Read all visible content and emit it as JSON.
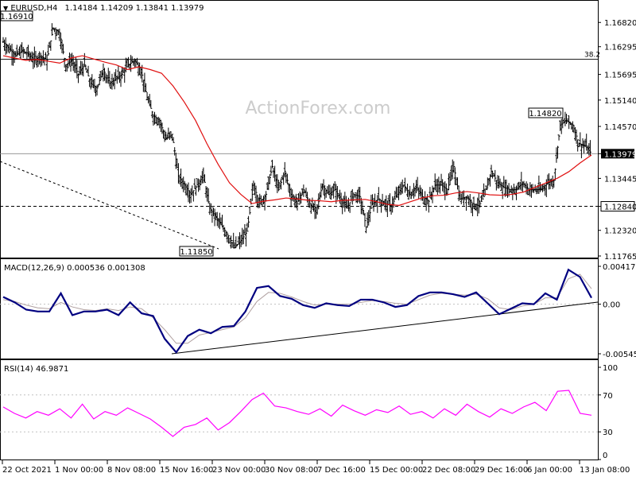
{
  "chart_data": [
    {
      "type": "line",
      "panel": "price",
      "symbol": "EURUSD,H4",
      "ohlc_header": "1.14184 1.14209 1.13841 1.13979",
      "last_price": "1.13979",
      "watermark": "ActionForex.com",
      "y_ticks": [
        "1.16820",
        "1.16295",
        "1.15695",
        "1.15140",
        "1.14570",
        "1.13979",
        "1.13445",
        "1.12840",
        "1.12320",
        "1.11765"
      ],
      "ylim": [
        1.11765,
        1.1691
      ],
      "labels": {
        "high": "1.16910",
        "low": "1.11850",
        "recent_high": "1.14820",
        "support": "1.12840",
        "fib": "38.2"
      },
      "fib_level": 1.16025,
      "support_level": 1.1284,
      "series": [
        {
          "name": "close",
          "values": [
            1.164,
            1.1625,
            1.161,
            1.162,
            1.1615,
            1.16,
            1.161,
            1.16,
            1.167,
            1.166,
            1.159,
            1.16,
            1.157,
            1.159,
            1.155,
            1.154,
            1.158,
            1.155,
            1.156,
            1.157,
            1.159,
            1.16,
            1.158,
            1.152,
            1.148,
            1.147,
            1.143,
            1.144,
            1.135,
            1.133,
            1.131,
            1.133,
            1.135,
            1.128,
            1.126,
            1.124,
            1.122,
            1.1195,
            1.121,
            1.123,
            1.133,
            1.129,
            1.131,
            1.137,
            1.132,
            1.136,
            1.131,
            1.129,
            1.132,
            1.129,
            1.127,
            1.133,
            1.131,
            1.132,
            1.13,
            1.128,
            1.131,
            1.1305,
            1.124,
            1.129,
            1.13,
            1.129,
            1.1285,
            1.131,
            1.133,
            1.131,
            1.1325,
            1.1305,
            1.1295,
            1.133,
            1.133,
            1.132,
            1.137,
            1.13,
            1.1305,
            1.129,
            1.1285,
            1.131,
            1.136,
            1.1335,
            1.1325,
            1.132,
            1.132,
            1.1335,
            1.132,
            1.132,
            1.132,
            1.1335,
            1.134,
            1.146,
            1.147,
            1.146,
            1.142,
            1.1415,
            1.1398
          ]
        },
        {
          "name": "moving_average",
          "values": [
            1.161,
            1.1605,
            1.16,
            1.1602,
            1.1598,
            1.1594,
            1.1605,
            1.161,
            1.1603,
            1.1596,
            1.159,
            1.158,
            1.1586,
            1.158,
            1.1572,
            1.1545,
            1.151,
            1.147,
            1.142,
            1.1375,
            1.1335,
            1.131,
            1.129,
            1.1295,
            1.1298,
            1.1302,
            1.13,
            1.1297,
            1.1296,
            1.1294,
            1.1297,
            1.1298,
            1.1299,
            1.1294,
            1.1288,
            1.1286,
            1.1294,
            1.1302,
            1.1307,
            1.1308,
            1.1313,
            1.1316,
            1.1313,
            1.1309,
            1.1308,
            1.131,
            1.1315,
            1.1325,
            1.1335,
            1.1345,
            1.1359,
            1.1378,
            1.1395
          ]
        }
      ]
    },
    {
      "type": "line",
      "panel": "macd",
      "title": "MACD(12,26,9) 0.000536 0.001308",
      "y_ticks": [
        "0.00417",
        "0.00",
        "-0.005456"
      ],
      "ylim": [
        -0.005456,
        0.00417
      ],
      "series": [
        {
          "name": "MACD",
          "values": [
            0.0008,
            0.0002,
            -0.0006,
            -0.0008,
            -0.0008,
            0.0012,
            -0.0012,
            -0.0008,
            -0.0008,
            -0.0006,
            -0.0012,
            0.0002,
            -0.001,
            -0.0013,
            -0.0038,
            -0.0053,
            -0.0035,
            -0.0028,
            -0.0032,
            -0.0025,
            -0.0024,
            -0.0008,
            0.0018,
            0.002,
            0.0009,
            0.0006,
            -0.0001,
            -0.0004,
            0.0001,
            -0.0001,
            -0.0002,
            0.0005,
            0.0005,
            0.0002,
            -0.0003,
            -0.0001,
            0.0009,
            0.0013,
            0.0013,
            0.0011,
            0.0008,
            0.0013,
            0.0001,
            -0.0011,
            -0.0005,
            0.0001,
            0.0,
            0.0012,
            0.0005,
            0.0038,
            0.003,
            0.0007
          ]
        },
        {
          "name": "signal",
          "values": [
            0.0005,
            0.0003,
            -0.0001,
            -0.0004,
            -0.0005,
            0.0002,
            -0.0003,
            -0.0006,
            -0.0007,
            -0.0005,
            -0.0007,
            -0.0003,
            -0.0005,
            -0.0015,
            -0.0028,
            -0.0043,
            -0.0043,
            -0.0034,
            -0.0031,
            -0.0028,
            -0.0025,
            -0.0015,
            0.0003,
            0.0013,
            0.0012,
            0.0008,
            0.0003,
            -0.0001,
            0.0,
            0.0,
            0.0,
            0.0002,
            0.0004,
            0.0003,
            0.0001,
            0.0,
            0.0005,
            0.001,
            0.0012,
            0.0011,
            0.001,
            0.0011,
            0.0006,
            -0.0004,
            -0.0006,
            -0.0002,
            0.0,
            0.0007,
            0.0007,
            0.0028,
            0.0033,
            0.0017
          ]
        }
      ]
    },
    {
      "type": "line",
      "panel": "rsi",
      "title": "RSI(14) 46.9871",
      "y_ticks": [
        "100",
        "70",
        "30",
        "0"
      ],
      "ylim": [
        0,
        100
      ],
      "levels": [
        70,
        30
      ],
      "series": [
        {
          "name": "RSI",
          "values": [
            57,
            50,
            45,
            52,
            48,
            55,
            45,
            60,
            44,
            52,
            48,
            56,
            50,
            44,
            35,
            25,
            35,
            38,
            45,
            32,
            40,
            52,
            65,
            72,
            58,
            56,
            52,
            49,
            55,
            47,
            59,
            53,
            48,
            54,
            51,
            58,
            49,
            52,
            45,
            55,
            48,
            60,
            52,
            46,
            55,
            50,
            57,
            62,
            53,
            74,
            75,
            50,
            48
          ]
        }
      ]
    }
  ],
  "x_ticks": [
    "22 Oct 2021",
    "1 Nov 00:00",
    "8 Nov 08:00",
    "15 Nov 16:00",
    "23 Nov 00:00",
    "30 Nov 08:00",
    "7 Dec 16:00",
    "15 Dec 00:00",
    "22 Dec 08:00",
    "29 Dec 16:00",
    "6 Jan 00:00",
    "13 Jan 08:00"
  ],
  "colors": {
    "candle": "#000000",
    "ma": "#e01010",
    "macd": "#000080",
    "signal": "#b0a0a0",
    "rsi": "#ff00ff",
    "label_text": "#000080"
  }
}
